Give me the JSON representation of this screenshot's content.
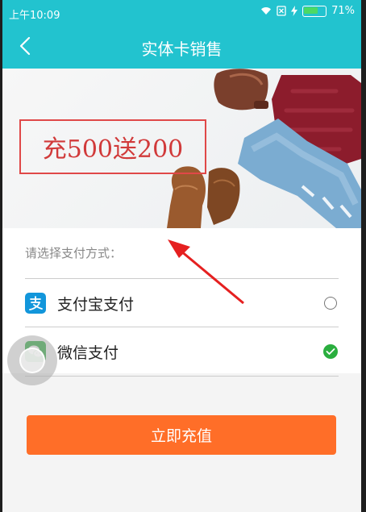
{
  "status_bar": {
    "time": "上午10:09",
    "battery_percent": "71%",
    "battery_level": 0.71
  },
  "header": {
    "title": "实体卡销售"
  },
  "banner": {
    "promo_text": "充500送200"
  },
  "payment": {
    "prompt": "请选择支付方式：",
    "methods": [
      {
        "label": "支付宝支付",
        "icon": "alipay-icon",
        "selected": false
      },
      {
        "label": "微信支付",
        "icon": "wechat-pay-icon",
        "selected": true
      }
    ]
  },
  "actions": {
    "submit_label": "立即充值"
  },
  "colors": {
    "header": "#22c3cf",
    "accent_orange": "#ff6e28",
    "alipay": "#1296db",
    "wechat": "#2aae3e",
    "promo_border": "#e04848",
    "battery": "#4cd964",
    "annotation_arrow": "#e52020"
  }
}
